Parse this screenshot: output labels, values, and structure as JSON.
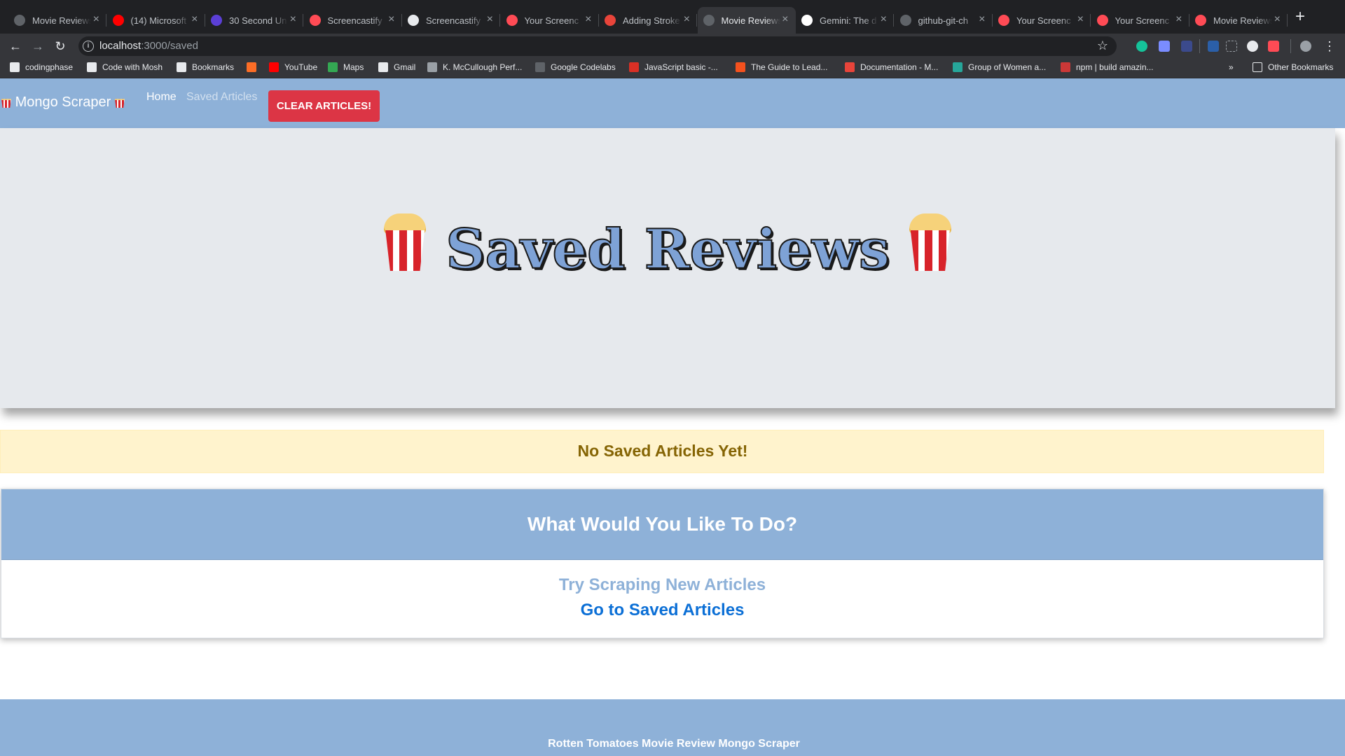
{
  "browser": {
    "tabs": [
      {
        "title": "Movie Reviews",
        "active": false,
        "icon_color": "#5f6368"
      },
      {
        "title": "(14) Microsoft",
        "active": false,
        "icon_color": "#ff0000"
      },
      {
        "title": "30 Second Un",
        "active": false,
        "icon_color": "#5b3fd6"
      },
      {
        "title": "Screencastify",
        "active": false,
        "icon_color": "#ff4b55"
      },
      {
        "title": "Screencastify",
        "active": false,
        "icon_color": "#e8eaed"
      },
      {
        "title": "Your Screenc",
        "active": false,
        "icon_color": "#ff4b55"
      },
      {
        "title": "Adding Stroke",
        "active": false,
        "icon_color": "#e8443a"
      },
      {
        "title": "Movie Reviews",
        "active": true,
        "icon_color": "#5f6368"
      },
      {
        "title": "Gemini: The d",
        "active": false,
        "icon_color": "#ffffff"
      },
      {
        "title": "github-git-ch",
        "active": false,
        "icon_color": "#5f6368"
      },
      {
        "title": "Your Screenc",
        "active": false,
        "icon_color": "#ff4b55"
      },
      {
        "title": "Your Screenc",
        "active": false,
        "icon_color": "#ff4b55"
      },
      {
        "title": "Movie Reviews",
        "active": false,
        "icon_color": "#ff4b55"
      }
    ],
    "close_glyph": "×",
    "new_tab_glyph": "+",
    "address": {
      "host": "localhost",
      "path": ":3000/saved"
    },
    "bookmarks": [
      {
        "label": "codingphase",
        "icon_color": "#e8eaed"
      },
      {
        "label": "Code with Mosh",
        "icon_color": "#e8eaed"
      },
      {
        "label": "Bookmarks",
        "icon_color": "#e8eaed"
      },
      {
        "label": "",
        "icon_color": "#fc6d26"
      },
      {
        "label": "YouTube",
        "icon_color": "#ff0000"
      },
      {
        "label": "Maps",
        "icon_color": "#34a853"
      },
      {
        "label": "Gmail",
        "icon_color": "#e8eaed"
      },
      {
        "label": "K. McCullough Perf...",
        "icon_color": "#9aa0a6"
      },
      {
        "label": "Google Codelabs",
        "icon_color": "#5f6368"
      },
      {
        "label": "JavaScript basic -...",
        "icon_color": "#d93025"
      },
      {
        "label": "The Guide to Lead...",
        "icon_color": "#f4511e"
      },
      {
        "label": "Documentation - M...",
        "icon_color": "#e8443a"
      },
      {
        "label": "Group of Women a...",
        "icon_color": "#26a69a"
      },
      {
        "label": "npm | build amazin...",
        "icon_color": "#cb3837"
      }
    ],
    "overflow_glyph": "»",
    "other_bookmarks": "Other Bookmarks"
  },
  "navbar": {
    "brand": "Mongo Scraper",
    "home": "Home",
    "saved": "Saved Articles",
    "clear_button": "Clear Articles!"
  },
  "jumbotron": {
    "title": "Saved Reviews"
  },
  "alert": {
    "text": "No Saved Articles Yet!"
  },
  "card": {
    "title": "What Would You Like To Do?",
    "scrape_link": "Try Scraping New Articles",
    "saved_link": "Go to Saved Articles"
  },
  "footer": {
    "text": "Rotten Tomatoes Movie Review Mongo Scraper"
  },
  "colors": {
    "brand_blue": "#8eb1d8",
    "danger": "#dc3545",
    "alert_bg": "#fff3cd",
    "alert_text": "#856404",
    "link": "#0b6fd6"
  }
}
